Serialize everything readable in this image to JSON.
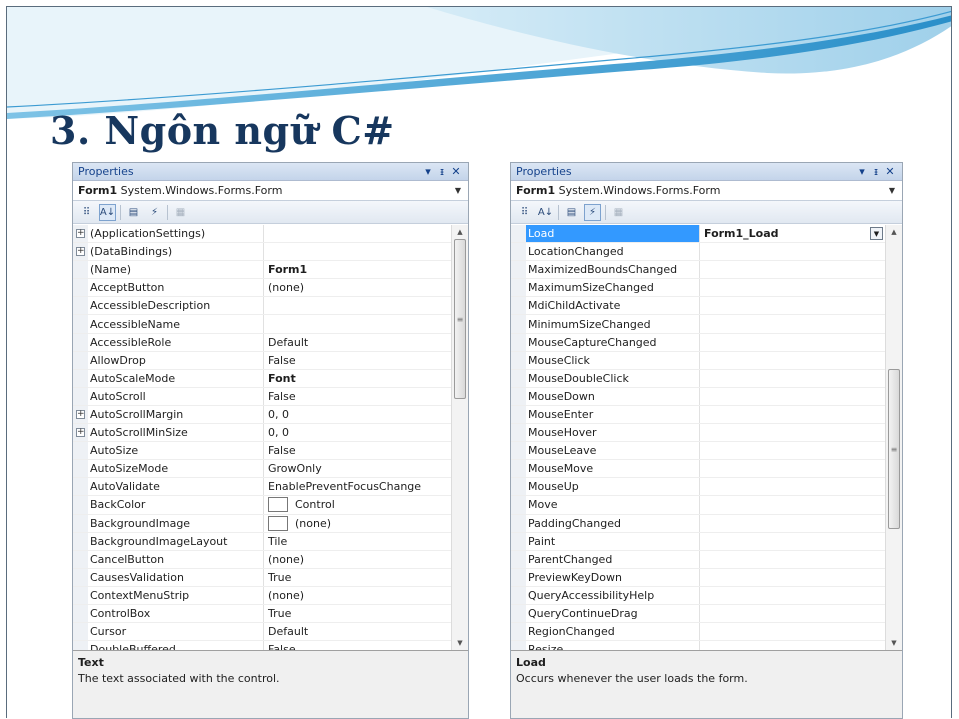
{
  "slide": {
    "title": "3. Ngôn ngữ C#"
  },
  "colors": {
    "title": "#17375e",
    "selection": "#3399ff",
    "panel_title_bg": "#c4d4ea"
  },
  "left_panel": {
    "title": "Properties",
    "pin_label": "ᵻ",
    "close_label": "✕",
    "dropdown_label": "▾",
    "object_name": "Form1",
    "object_type": "System.Windows.Forms.Form",
    "toolbar": {
      "categorized": "⠿",
      "alphabetical": "A↓",
      "properties": "▤",
      "events": "⚡",
      "pages": "▦",
      "active_view": "alphabetical"
    },
    "rows": [
      {
        "expand": "+",
        "name": "(ApplicationSettings)",
        "value": ""
      },
      {
        "expand": "+",
        "name": "(DataBindings)",
        "value": ""
      },
      {
        "expand": "",
        "name": "(Name)",
        "value": "Form1",
        "bold": true
      },
      {
        "expand": "",
        "name": "AcceptButton",
        "value": "(none)"
      },
      {
        "expand": "",
        "name": "AccessibleDescription",
        "value": ""
      },
      {
        "expand": "",
        "name": "AccessibleName",
        "value": ""
      },
      {
        "expand": "",
        "name": "AccessibleRole",
        "value": "Default"
      },
      {
        "expand": "",
        "name": "AllowDrop",
        "value": "False"
      },
      {
        "expand": "",
        "name": "AutoScaleMode",
        "value": "Font",
        "bold": true
      },
      {
        "expand": "",
        "name": "AutoScroll",
        "value": "False"
      },
      {
        "expand": "+",
        "name": "AutoScrollMargin",
        "value": "0, 0"
      },
      {
        "expand": "+",
        "name": "AutoScrollMinSize",
        "value": "0, 0"
      },
      {
        "expand": "",
        "name": "AutoSize",
        "value": "False"
      },
      {
        "expand": "",
        "name": "AutoSizeMode",
        "value": "GrowOnly"
      },
      {
        "expand": "",
        "name": "AutoValidate",
        "value": "EnablePreventFocusChange"
      },
      {
        "expand": "",
        "name": "BackColor",
        "value": "Control",
        "swatch": true
      },
      {
        "expand": "",
        "name": "BackgroundImage",
        "value": "(none)",
        "swatch": true
      },
      {
        "expand": "",
        "name": "BackgroundImageLayout",
        "value": "Tile"
      },
      {
        "expand": "",
        "name": "CancelButton",
        "value": "(none)"
      },
      {
        "expand": "",
        "name": "CausesValidation",
        "value": "True"
      },
      {
        "expand": "",
        "name": "ContextMenuStrip",
        "value": "(none)"
      },
      {
        "expand": "",
        "name": "ControlBox",
        "value": "True"
      },
      {
        "expand": "",
        "name": "Cursor",
        "value": "Default"
      },
      {
        "expand": "",
        "name": "DoubleBuffered",
        "value": "False"
      }
    ],
    "scroll": {
      "up": "▲",
      "down": "▼",
      "grip": "≡",
      "position": 0.0
    },
    "description": {
      "title": "Text",
      "text": "The text associated with the control."
    }
  },
  "right_panel": {
    "title": "Properties",
    "pin_label": "ᵻ",
    "close_label": "✕",
    "dropdown_label": "▾",
    "object_name": "Form1",
    "object_type": "System.Windows.Forms.Form",
    "toolbar": {
      "categorized": "⠿",
      "alphabetical": "A↓",
      "properties": "▤",
      "events": "⚡",
      "pages": "▦",
      "active_view": "events"
    },
    "rows": [
      {
        "name": "Load",
        "value": "Form1_Load",
        "selected": true
      },
      {
        "name": "LocationChanged",
        "value": ""
      },
      {
        "name": "MaximizedBoundsChanged",
        "value": ""
      },
      {
        "name": "MaximumSizeChanged",
        "value": ""
      },
      {
        "name": "MdiChildActivate",
        "value": ""
      },
      {
        "name": "MinimumSizeChanged",
        "value": ""
      },
      {
        "name": "MouseCaptureChanged",
        "value": ""
      },
      {
        "name": "MouseClick",
        "value": ""
      },
      {
        "name": "MouseDoubleClick",
        "value": ""
      },
      {
        "name": "MouseDown",
        "value": ""
      },
      {
        "name": "MouseEnter",
        "value": ""
      },
      {
        "name": "MouseHover",
        "value": ""
      },
      {
        "name": "MouseLeave",
        "value": ""
      },
      {
        "name": "MouseMove",
        "value": ""
      },
      {
        "name": "MouseUp",
        "value": ""
      },
      {
        "name": "Move",
        "value": ""
      },
      {
        "name": "PaddingChanged",
        "value": ""
      },
      {
        "name": "Paint",
        "value": ""
      },
      {
        "name": "ParentChanged",
        "value": ""
      },
      {
        "name": "PreviewKeyDown",
        "value": ""
      },
      {
        "name": "QueryAccessibilityHelp",
        "value": ""
      },
      {
        "name": "QueryContinueDrag",
        "value": ""
      },
      {
        "name": "RegionChanged",
        "value": ""
      },
      {
        "name": "Resize",
        "value": ""
      }
    ],
    "value_dropdown": "▼",
    "scroll": {
      "up": "▲",
      "down": "▼",
      "grip": "≡",
      "position": 0.55
    },
    "description": {
      "title": "Load",
      "text": "Occurs whenever the user loads the form."
    }
  }
}
